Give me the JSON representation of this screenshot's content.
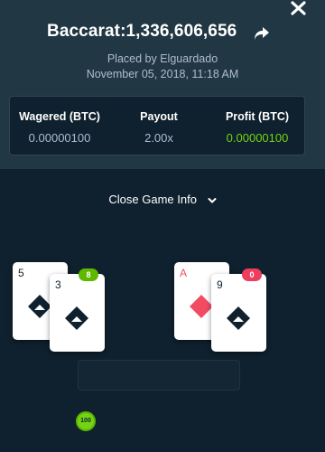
{
  "header": {
    "title": "Baccarat:1,336,606,656",
    "placed_by": "Placed by Elguardado",
    "date": "November 05, 2018, 11:18 AM"
  },
  "stats": {
    "wagered_label": "Wagered (BTC)",
    "wagered_value": "0.00000100",
    "payout_label": "Payout",
    "payout_value": "2.00x",
    "profit_label": "Profit (BTC)",
    "profit_value": "0.00000100"
  },
  "game_info": {
    "toggle_label": "Close Game Info"
  },
  "hands": {
    "player": {
      "score": "8",
      "cards": [
        {
          "rank": "5",
          "suit": "spades"
        },
        {
          "rank": "3",
          "suit": "spades"
        }
      ]
    },
    "banker": {
      "score": "0",
      "cards": [
        {
          "rank": "A",
          "suit": "diamonds"
        },
        {
          "rank": "9",
          "suit": "spades"
        }
      ]
    }
  },
  "chip": {
    "label": "100"
  },
  "colors": {
    "panel": "#213743",
    "background": "#0f212e",
    "muted_text": "#b1bad3",
    "profit_green": "#74d314",
    "player_badge": "#5fb800",
    "banker_badge": "#ef3d5e",
    "diamond_red": "#f14d62",
    "spade_black": "#0f212e"
  },
  "icons": [
    "close-icon",
    "share-icon",
    "chevron-down-icon",
    "spade-icon",
    "diamond-icon"
  ]
}
